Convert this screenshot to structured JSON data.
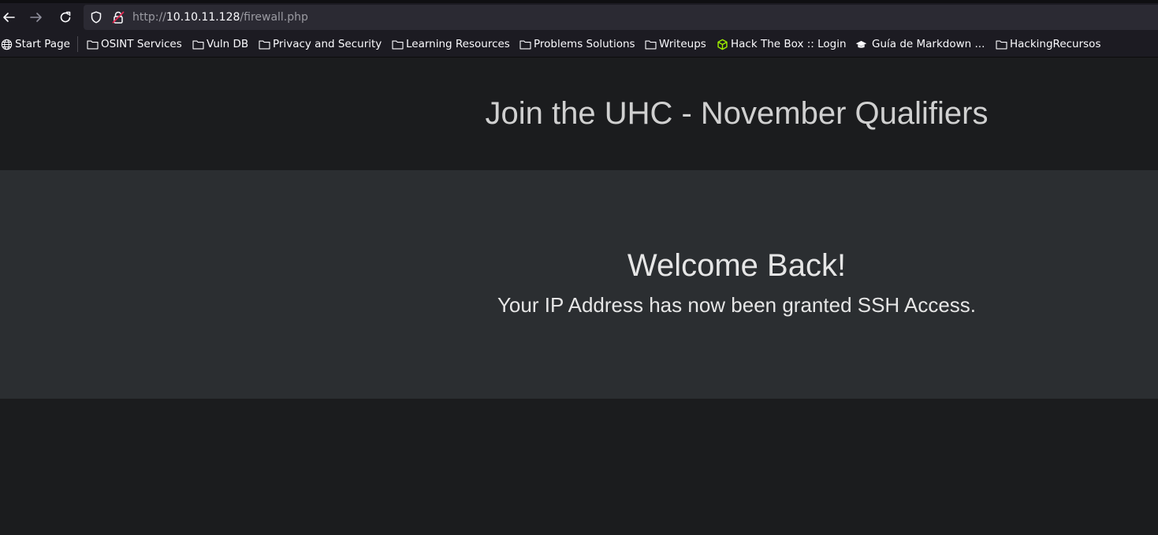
{
  "browser": {
    "url": {
      "scheme": "http://",
      "host": "10.10.11.128",
      "path": "/firewall.php"
    },
    "icons": {
      "back": "arrow-left-icon",
      "forward": "arrow-right-icon",
      "reload": "reload-icon",
      "tracking_protection": "shield-icon",
      "insecure": "lock-insecure-icon"
    }
  },
  "bookmarks": [
    {
      "label": "Start Page",
      "icon": "globe-icon"
    },
    {
      "label": "OSINT Services",
      "icon": "folder-icon"
    },
    {
      "label": "Vuln DB",
      "icon": "folder-icon"
    },
    {
      "label": "Privacy and Security",
      "icon": "folder-icon"
    },
    {
      "label": "Learning Resources",
      "icon": "folder-icon"
    },
    {
      "label": "Problems Solutions",
      "icon": "folder-icon"
    },
    {
      "label": "Writeups",
      "icon": "folder-icon"
    },
    {
      "label": "Hack The Box :: Login",
      "icon": "htb-cube-icon"
    },
    {
      "label": "Guía de Markdown ...",
      "icon": "graduation-cap-icon"
    },
    {
      "label": "HackingRecursos",
      "icon": "folder-icon"
    }
  ],
  "page": {
    "title": "Join the UHC - November Qualifiers",
    "welcome_heading": "Welcome Back!",
    "welcome_message": "Your IP Address has now been granted SSH Access."
  },
  "colors": {
    "page_background": "#1b1c1e",
    "panel_background": "#2b2e31",
    "title_text": "#d0d0d0",
    "htb_green": "#9fef00"
  }
}
